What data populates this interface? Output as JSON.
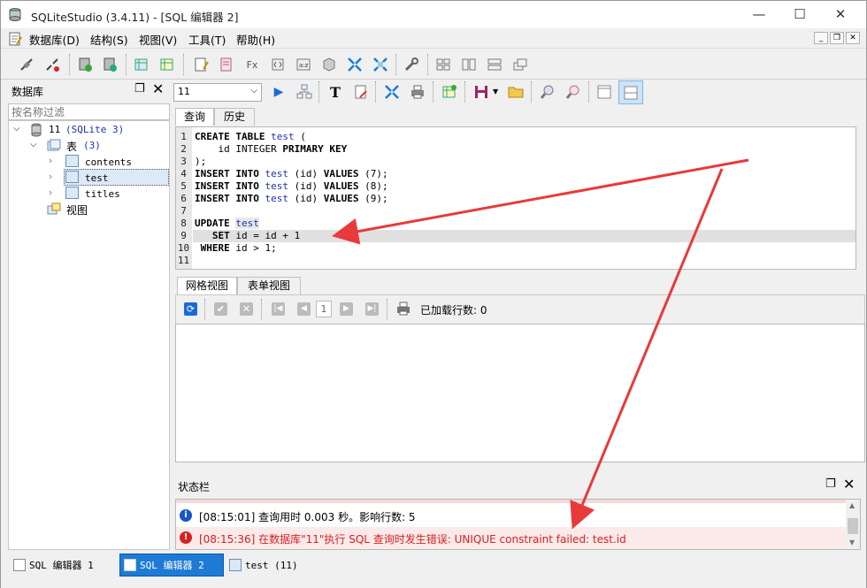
{
  "window": {
    "title": "SQLiteStudio (3.4.11) - [SQL 编辑器 2]"
  },
  "menu": [
    "数据库(D)",
    "结构(S)",
    "视图(V)",
    "工具(T)",
    "帮助(H)"
  ],
  "left_panel": {
    "title": "数据库",
    "filter_placeholder": "按名称过滤",
    "db_name": "11",
    "db_type": "(SQLite 3)",
    "tables_label": "表",
    "tables_count": "(3)",
    "tables": [
      "contents",
      "test",
      "titles"
    ],
    "views_label": "视图"
  },
  "editor": {
    "db_combo": "11",
    "tabs": [
      "查询",
      "历史"
    ],
    "line_numbers": [
      "1",
      "2",
      "3",
      "4",
      "5",
      "6",
      "7",
      "8",
      "9",
      "10",
      "11"
    ]
  },
  "results": {
    "tabs": [
      "网格视图",
      "表单视图"
    ],
    "page": "1",
    "rows_loaded": "已加载行数: 0"
  },
  "status": {
    "title": "状态栏",
    "messages": [
      {
        "type": "info",
        "time": "[08:15:01]",
        "text": "查询用时 0.003 秒。影响行数: 5"
      },
      {
        "type": "error",
        "time": "[08:15:36]",
        "text": "在数据库\"11\"执行 SQL 查询时发生错误: UNIQUE constraint failed: test.id"
      }
    ]
  },
  "taskbar": {
    "items": [
      "SQL 编辑器 1",
      "SQL 编辑器 2",
      "test (11)"
    ]
  },
  "colors": {
    "accent": "#1d7bd6",
    "error": "#d82020",
    "info": "#1a56c8",
    "arrow": "#e83a3a"
  }
}
